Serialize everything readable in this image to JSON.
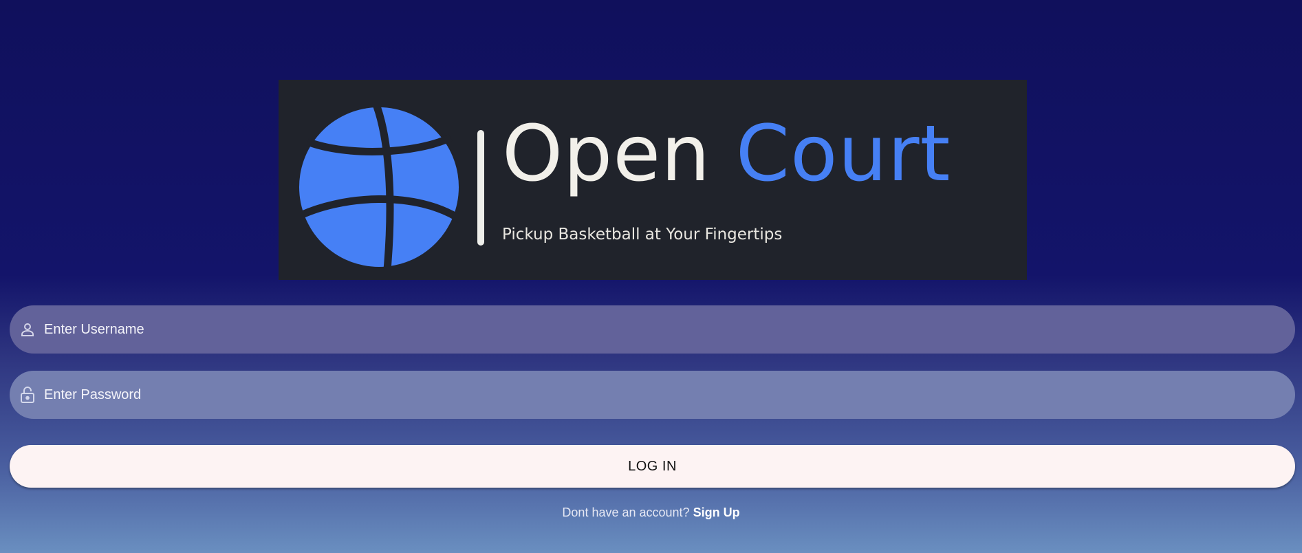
{
  "logo": {
    "title_word1": "Open",
    "title_word2": "Court",
    "tagline": "Pickup Basketball at Your Fingertips",
    "icon": "basketball-icon",
    "colors": {
      "background": "#20232b",
      "ball": "#4680f5",
      "title_light": "#f2f0ea",
      "title_accent": "#4680f5"
    }
  },
  "form": {
    "username": {
      "placeholder": "Enter Username",
      "value": "",
      "icon": "person-icon"
    },
    "password": {
      "placeholder": "Enter Password",
      "value": "",
      "icon": "lock-icon"
    },
    "login_label": "LOG IN"
  },
  "signup": {
    "prompt": "Dont have an account?",
    "link_label": "Sign Up"
  }
}
